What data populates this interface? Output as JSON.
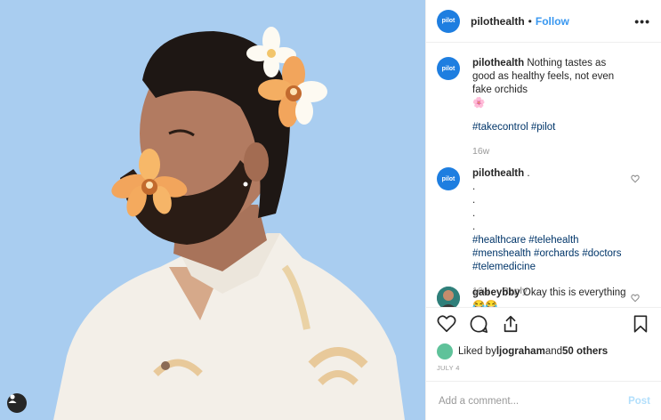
{
  "header": {
    "avatar_text": "pilot",
    "username": "pilothealth",
    "separator": "•",
    "follow_label": "Follow",
    "more_label": "•••"
  },
  "caption": {
    "avatar_text": "pilot",
    "username": "pilothealth",
    "text": "Nothing tastes as good as healthy feels, not even fake orchids",
    "emoji": "🌸",
    "hashtags": "#takecontrol #pilot",
    "time": "16w"
  },
  "comment1": {
    "avatar_text": "pilot",
    "username": "pilothealth",
    "text_suffix": " .",
    "dots": [
      ".",
      ".",
      ".",
      "."
    ],
    "hashtag_lines": [
      "#healthcare #telehealth",
      "#menshealth #orchards #doctors",
      "#telemedicine"
    ],
    "time": "16w",
    "reply_label": "Reply"
  },
  "comment2": {
    "username": "gabeybby",
    "text": "Okay this is everything",
    "emoji": "😂😂"
  },
  "likes": {
    "prefix": "Liked by ",
    "user": "ljograham",
    "middle": " and ",
    "others": "50 others"
  },
  "date": "JULY 4",
  "add_comment": {
    "placeholder": "Add a comment...",
    "post_label": "Post"
  },
  "colors": {
    "background_blue": "#a9cdf0",
    "brand_blue": "#1e7ee0",
    "follow_blue": "#3897f0",
    "hashtag": "#003569"
  },
  "icons": [
    "heart-icon",
    "comment-icon",
    "share-icon",
    "bookmark-icon",
    "user-tag-icon",
    "more-icon"
  ]
}
